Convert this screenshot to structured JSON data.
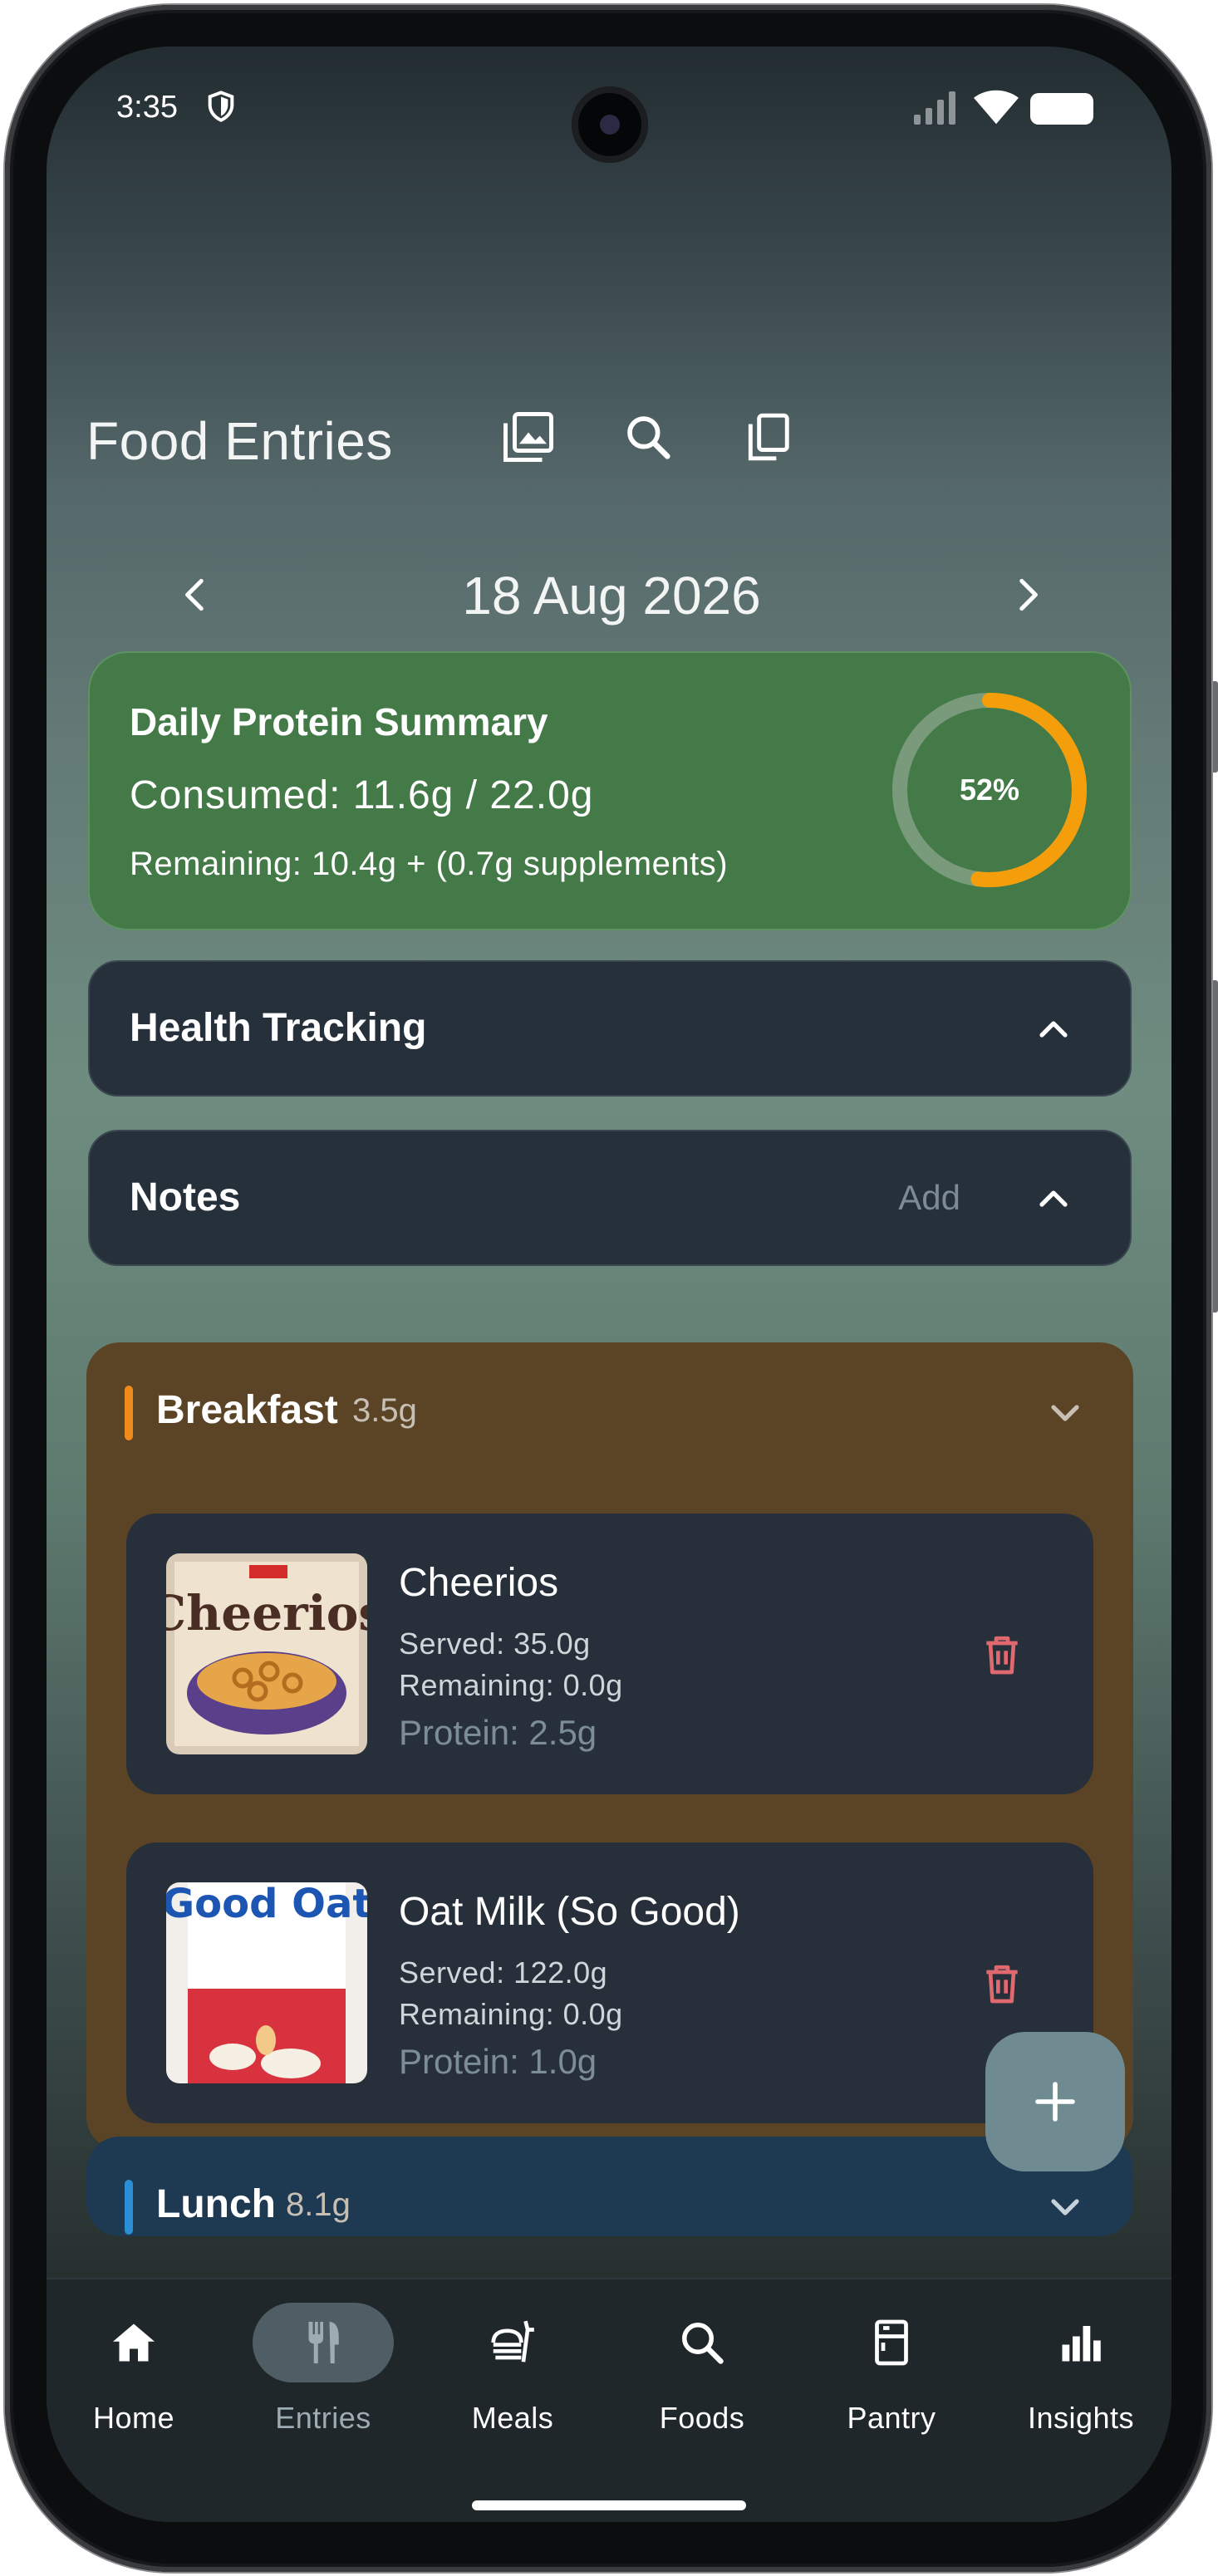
{
  "status_bar": {
    "time": "3:35"
  },
  "header": {
    "title": "Food Entries",
    "icons": [
      "gallery-icon",
      "search-icon",
      "copy-icon"
    ]
  },
  "date_nav": {
    "date": "18 Aug 2026"
  },
  "summary": {
    "title": "Daily Protein Summary",
    "consumed": "Consumed: 11.6g / 22.0g",
    "remaining": "Remaining: 10.4g  + (0.7g supplements)",
    "percent_label": "52%",
    "percent_value": 0.52,
    "colors": {
      "card": "#437a47",
      "ring": "#f59e0b",
      "track": "#7a9a7c"
    }
  },
  "health_tracking": {
    "label": "Health Tracking"
  },
  "notes": {
    "label": "Notes",
    "add_label": "Add"
  },
  "meals": [
    {
      "name": "Breakfast",
      "amount": "3.5g",
      "accent": "#f08a1a",
      "entries": [
        {
          "name": "Cheerios",
          "served": "Served: 35.0g",
          "remaining": "Remaining: 0.0g",
          "protein": "Protein: 2.5g",
          "image_text": "Cheerios"
        },
        {
          "name": "Oat Milk (So Good)",
          "served": "Served: 122.0g",
          "remaining": "Remaining: 0.0g",
          "protein": "Protein: 1.0g",
          "image_text": "Good Oat"
        }
      ]
    },
    {
      "name": "Lunch",
      "amount": "8.1g",
      "accent": "#2b8fd6",
      "entries": []
    }
  ],
  "nav": [
    {
      "label": "Home",
      "icon": "home-icon",
      "active": false
    },
    {
      "label": "Entries",
      "icon": "cutlery-icon",
      "active": true
    },
    {
      "label": "Meals",
      "icon": "meals-icon",
      "active": false
    },
    {
      "label": "Foods",
      "icon": "search-icon",
      "active": false
    },
    {
      "label": "Pantry",
      "icon": "pantry-icon",
      "active": false
    },
    {
      "label": "Insights",
      "icon": "bar-chart-icon",
      "active": false
    }
  ]
}
